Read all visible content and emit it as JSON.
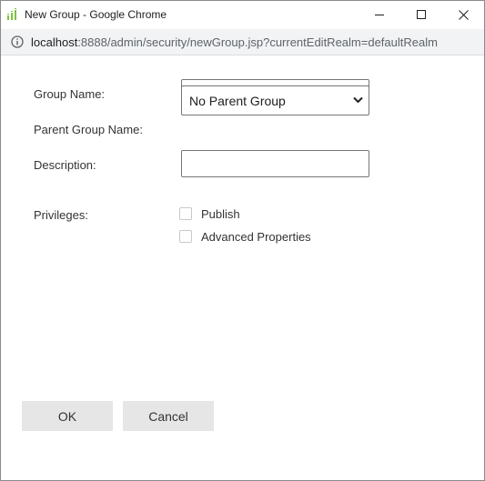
{
  "window": {
    "title": "New Group - Google Chrome",
    "url_host": "localhost",
    "url_rest": ":8888/admin/security/newGroup.jsp?currentEditRealm=defaultRealm",
    "icons": {
      "app": "app-logo-icon",
      "minimize": "minimize-icon",
      "maximize": "maximize-icon",
      "close": "close-icon",
      "info": "info-icon"
    }
  },
  "form": {
    "group_name_label": "Group Name:",
    "group_name_value": "",
    "parent_group_label": "Parent Group Name:",
    "parent_group_value": "No Parent Group",
    "description_label": "Description:",
    "description_value": "",
    "privileges_label": "Privileges:",
    "privileges": [
      {
        "label": "Publish",
        "checked": false
      },
      {
        "label": "Advanced Properties",
        "checked": false
      }
    ]
  },
  "buttons": {
    "ok": "OK",
    "cancel": "Cancel"
  }
}
